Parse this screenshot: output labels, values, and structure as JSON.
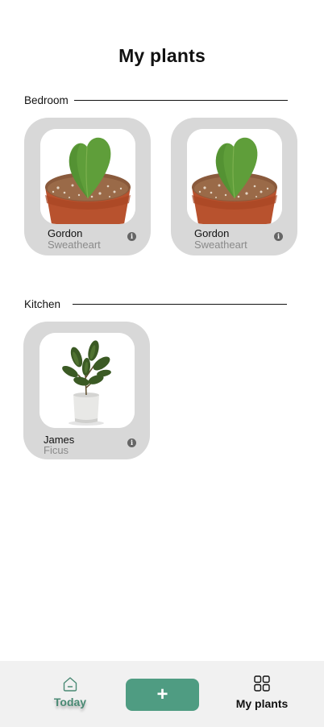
{
  "header": {
    "title": "My plants"
  },
  "sections": [
    {
      "label": "Bedroom",
      "plants": [
        {
          "name": "Gordon",
          "species": "Sweatheart",
          "photo_icon": "hoya-heart-plant"
        },
        {
          "name": "Gordon",
          "species": "Sweatheart",
          "photo_icon": "hoya-heart-plant"
        }
      ]
    },
    {
      "label": "Kitchen",
      "plants": [
        {
          "name": "James",
          "species": "Ficus",
          "photo_icon": "ficus-plant"
        }
      ]
    }
  ],
  "info_glyph": "i",
  "tabbar": {
    "today_label": "Today",
    "add_label": "+",
    "my_plants_label": "My plants"
  },
  "colors": {
    "accent": "#4f9c82",
    "today_active": "#4a8a74",
    "card_bg": "#d8d8d8",
    "tabbar_bg": "#f1f1f1"
  }
}
